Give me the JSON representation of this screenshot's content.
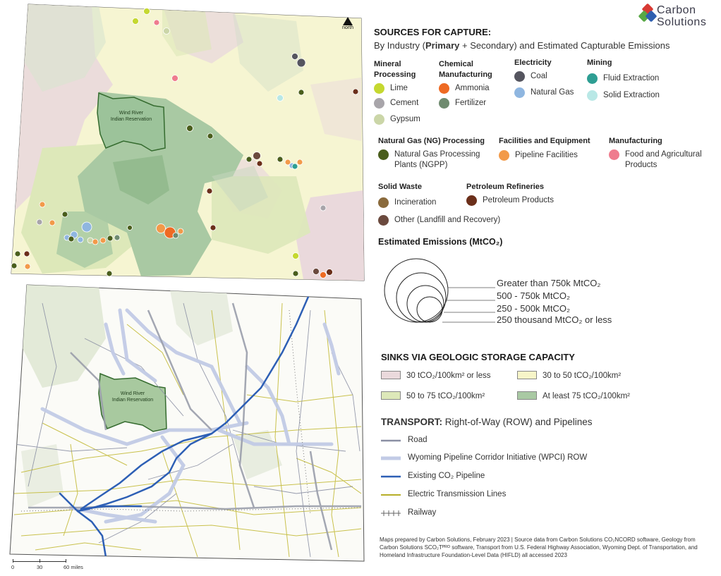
{
  "map_top": {
    "reservation_label_1": "Wind River",
    "reservation_label_2": "Indian Reservation",
    "north_label": "north",
    "colors": {
      "pink": "#ead9dc",
      "yellow": "#f5f3c9",
      "lightgreen": "#dde8b9",
      "darkgreen": "#a9c9a3",
      "terrain": "#e6ecd9"
    }
  },
  "map_bottom": {
    "reservation_label_1": "Wind River",
    "reservation_label_2": "Indian Reservation"
  },
  "scalebar": {
    "zero": "0",
    "mid": "30",
    "end": "60 miles"
  },
  "logo": {
    "line1": "Carbon",
    "line2": "Solutions"
  },
  "legend": {
    "sources_title": "SOURCES FOR CAPTURE:",
    "sources_sub_pre": "By Industry (",
    "sources_sub_bold": "Primary",
    "sources_sub_post": " + Secondary) and Estimated Capturable Emissions",
    "groups": {
      "mineral": {
        "title_1": "Mineral",
        "title_2": "Processing",
        "items": [
          {
            "label": "Lime",
            "color": "#c5d830"
          },
          {
            "label": "Cement",
            "color": "#a8a5aa"
          },
          {
            "label": "Gypsum",
            "color": "#cbd6a8"
          }
        ]
      },
      "chemical": {
        "title_1": "Chemical",
        "title_2": "Manufacturing",
        "items": [
          {
            "label": "Ammonia",
            "color": "#ee6a23"
          },
          {
            "label": "Fertilizer",
            "color": "#6f8b6f"
          }
        ]
      },
      "electricity": {
        "title": "Electricity",
        "items": [
          {
            "label": "Coal",
            "color": "#55555f"
          },
          {
            "label": "Natural Gas",
            "color": "#8fb6e0"
          }
        ]
      },
      "mining": {
        "title": "Mining",
        "items": [
          {
            "label": "Fluid Extraction",
            "color": "#2e9e93"
          },
          {
            "label": "Solid Extraction",
            "color": "#b9e8e6"
          }
        ]
      },
      "ng": {
        "title": "Natural Gas (NG) Processing",
        "items": [
          {
            "label_1": "Natural Gas Processing",
            "label_2": "Plants (NGPP)",
            "color": "#4a5e1c"
          }
        ]
      },
      "facilities": {
        "title": "Facilities and Equipment",
        "items": [
          {
            "label": "Pipeline Facilities",
            "color": "#f29a4a"
          }
        ]
      },
      "manufacturing": {
        "title": "Manufacturing",
        "items": [
          {
            "label_1": "Food and Agricultural",
            "label_2": "Products",
            "color": "#ef7c8e"
          }
        ]
      },
      "solid_waste": {
        "title": "Solid Waste",
        "items": [
          {
            "label": "Incineration",
            "color": "#8a6a3c"
          },
          {
            "label": "Other (Landfill and Recovery)",
            "color": "#6b4a3e"
          }
        ]
      },
      "petroleum": {
        "title": "Petroleum Refineries",
        "items": [
          {
            "label": "Petroleum Products",
            "color": "#6b2f1a"
          }
        ]
      }
    },
    "emissions_title": "Estimated Emissions (MtCO₂)",
    "emissions_classes": [
      "Greater than 750k MtCO₂",
      "500 - 750k MtCO₂",
      "250 - 500k MtCO₂",
      "250 thousand MtCO₂ or less"
    ],
    "sinks_title": "SINKS VIA GEOLOGIC STORAGE CAPACITY",
    "sinks": [
      {
        "label": "30 tCO₂/100km² or less",
        "color": "#ead9dc"
      },
      {
        "label": "30 to 50 tCO₂/100km²",
        "color": "#f7f5c8"
      },
      {
        "label": "50 to 75 tCO₂/100km²",
        "color": "#dde8b9"
      },
      {
        "label": "At least 75 tCO₂/100km²",
        "color": "#a9c9a3"
      }
    ],
    "transport_title_bold": "TRANSPORT:",
    "transport_title_rest": " Right-of-Way (ROW) and Pipelines",
    "transport": [
      {
        "label": "Road",
        "color": "#8a8fa3"
      },
      {
        "label": "Wyoming Pipeline Corridor Initiative (WPCI) ROW",
        "color": "#c2cbe6"
      },
      {
        "label": "Existing CO₂ Pipeline",
        "color": "#2d5fb5"
      },
      {
        "label": "Electric Transmission Lines",
        "color": "#b7ae28"
      },
      {
        "label": "Railway",
        "color": "#666666"
      }
    ],
    "footnote": "Maps prepared by Carbon Solutions, February 2023 | Source data from Carbon Solutions CO₂NCORD software, Geology from Carbon Solutions SCO₂Tᴾᴿᴼ software, Transport from U.S. Federal Highway Association, Wyoming Dept. of Transportation, and Homeland Infrastructure Foundation-Level Data (HIFLD) all accessed 2023"
  }
}
